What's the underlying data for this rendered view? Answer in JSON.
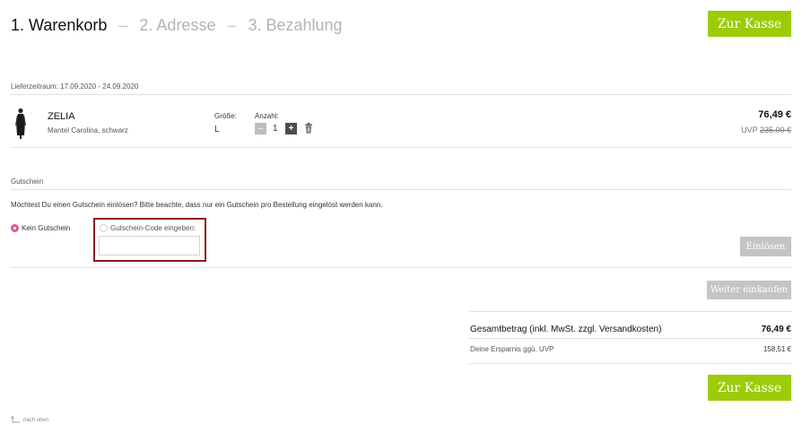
{
  "steps": [
    {
      "label": "1. Warenkorb"
    },
    {
      "label": "2. Adresse"
    },
    {
      "label": "3. Bezahlung"
    }
  ],
  "step_separator": "–",
  "checkout_label": "Zur Kasse",
  "delivery": {
    "label": "Lieferzeitraum:",
    "value": "17.09.2020 - 24.09.2020"
  },
  "product": {
    "name": "ZELIA",
    "description": "Mantel Carolina, schwarz",
    "size_label": "Größe:",
    "size_value": "L",
    "qty_label": "Anzahl:",
    "qty_minus": "–",
    "qty_value": "1",
    "qty_plus": "+",
    "price": "76,49 €",
    "uvp_label": "UVP",
    "uvp_price": "235,00 €"
  },
  "voucher": {
    "section_title": "Gutschein",
    "question": "Möchtest Du einen Gutschein einlösen? Bitte beachte, dass nur ein Gutschein pro Bestellung eingelöst werden kann.",
    "option_none": "Kein Gutschein",
    "option_code": "Gutschein-Code eingeben:",
    "input_value": "",
    "redeem_label": "Einlösen"
  },
  "continue_shopping_label": "Weiter einkaufen",
  "summary": {
    "total_label": "Gesamtbetrag (inkl. MwSt. zzgl. Versandkosten)",
    "total_value": "76,49 €",
    "savings_label": "Deine Ersparnis ggü. UVP",
    "savings_value": "158,51 €"
  },
  "back_to_top_label": "nach oben",
  "colors": {
    "accent": "#9ccc07",
    "radio": "#e0559c",
    "highlight_border": "#8b1a1a",
    "disabled": "#c4c4c4"
  }
}
